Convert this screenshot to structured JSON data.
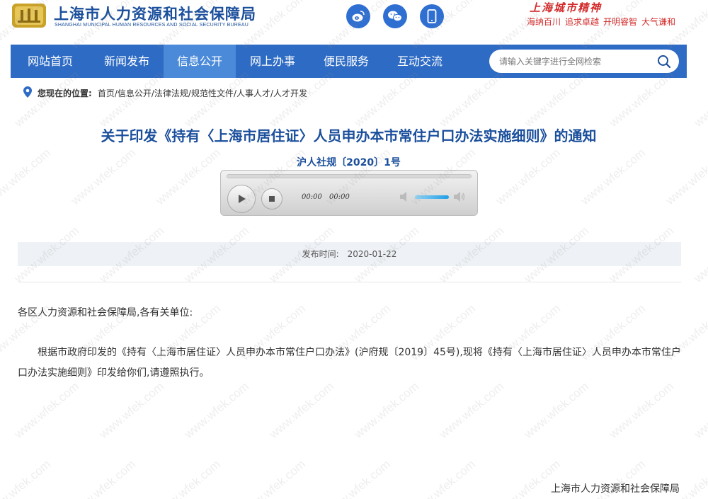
{
  "header": {
    "site_name": "上海市人力资源和社会保障局",
    "site_name_en": "SHANGHAI MUNICIPAL HUMAN RESOURCES AND SOCIAL SECURITY BUREAU",
    "social_icons": [
      "weibo-icon",
      "wechat-icon",
      "mobile-icon"
    ],
    "spirit_title": "上海城市精神",
    "spirit_words": [
      "海纳百川",
      "追求卓越",
      "开明睿智",
      "大气谦和"
    ]
  },
  "nav": {
    "items": [
      {
        "label": "网站首页",
        "active": false
      },
      {
        "label": "新闻发布",
        "active": false
      },
      {
        "label": "信息公开",
        "active": true
      },
      {
        "label": "网上办事",
        "active": false
      },
      {
        "label": "便民服务",
        "active": false
      },
      {
        "label": "互动交流",
        "active": false
      }
    ],
    "search_placeholder": "请输入关键字进行全网检索"
  },
  "breadcrumb": {
    "label": "您现在的位置:",
    "items": [
      "首页/",
      "信息公开/",
      "法律法规/",
      "规范性文件/",
      "人事人才/",
      "人才开发"
    ]
  },
  "article": {
    "title": "关于印发《持有〈上海市居住证〉人员申办本市常住户口办法实施细则》的通知",
    "doc_number": "沪人社规〔2020〕1号",
    "player": {
      "current_time": "00:00",
      "duration": "00:00"
    },
    "publish_label": "发布时间:",
    "publish_date": "2020-01-22",
    "salutation": "各区人力资源和社会保障局,各有关单位:",
    "paragraph": "根据市政府印发的《持有〈上海市居住证〉人员申办本市常住户口办法》(沪府规〔2019〕45号),现将《持有〈上海市居住证〉人员申办本市常住户口办法实施细则》印发给你们,请遵照执行。",
    "signature": "上海市人力资源和社会保障局"
  },
  "colors": {
    "brand_blue": "#1b4f9c",
    "nav_bg": "#2e6bc4",
    "nav_active": "#4a8ad9",
    "spirit_red": "#d32a2a"
  },
  "watermark": "www.wfek.com"
}
